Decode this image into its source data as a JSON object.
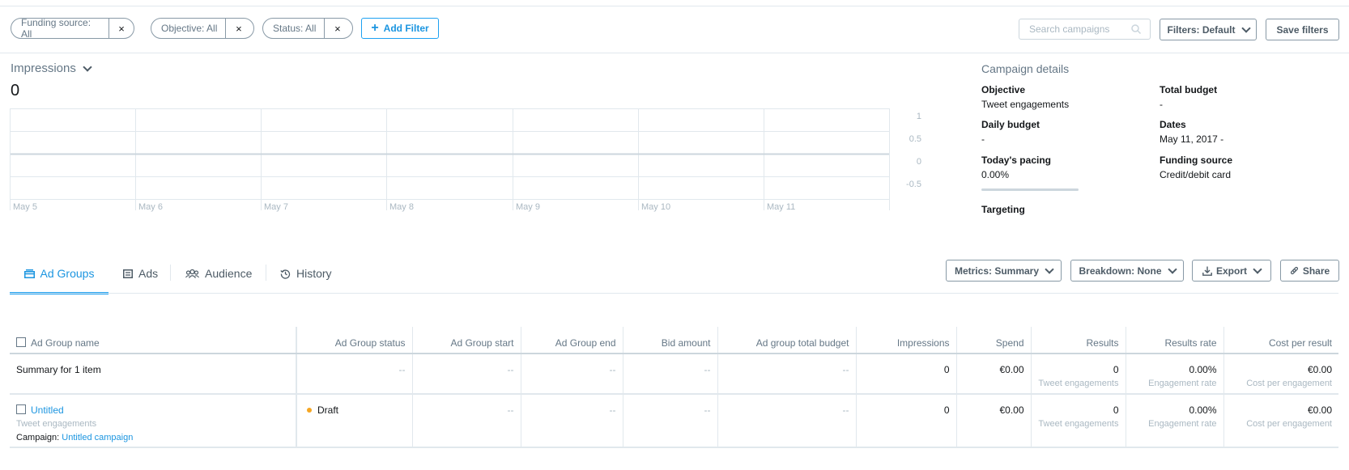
{
  "filters": {
    "chips": [
      {
        "label": "Funding source: All"
      },
      {
        "label": "Objective: All"
      },
      {
        "label": "Status: All"
      }
    ],
    "add_filter_label": "Add Filter",
    "search_placeholder": "Search campaigns",
    "filters_default_label": "Filters: Default",
    "save_filters_label": "Save filters",
    "close_glyph": "×"
  },
  "impressions": {
    "metric_label": "Impressions",
    "total": "0"
  },
  "chart_data": {
    "type": "line",
    "title": "",
    "x": [
      "May 5",
      "May 6",
      "May 7",
      "May 8",
      "May 9",
      "May 10",
      "May 11"
    ],
    "series": [
      {
        "values": [
          0,
          0,
          0,
          0,
          0,
          0,
          0
        ]
      }
    ],
    "y_ticks": [
      "1",
      "0.5",
      "0",
      "-0.5"
    ],
    "ylim": [
      -1,
      1
    ],
    "grid": true,
    "colors": {
      "grid": "#e1e8ed",
      "zero_line": "#ccd6dd",
      "tick": "#aab8c2"
    }
  },
  "campaign_details": {
    "title": "Campaign details",
    "objective_label": "Objective",
    "objective_value": "Tweet engagements",
    "total_budget_label": "Total budget",
    "total_budget_value": "-",
    "daily_budget_label": "Daily budget",
    "daily_budget_value": "-",
    "dates_label": "Dates",
    "dates_value": "May 11, 2017 -",
    "pacing_label": "Today's pacing",
    "pacing_value": "0.00%",
    "funding_source_label": "Funding source",
    "funding_source_value": "Credit/debit card",
    "targeting_label": "Targeting"
  },
  "tabs": [
    {
      "label": "Ad Groups",
      "icon": "ad-groups-icon",
      "active": true
    },
    {
      "label": "Ads",
      "icon": "ads-icon",
      "active": false
    },
    {
      "label": "Audience",
      "icon": "audience-icon",
      "active": false
    },
    {
      "label": "History",
      "icon": "history-icon",
      "active": false
    }
  ],
  "toolbar": {
    "metrics_label": "Metrics: Summary",
    "breakdown_label": "Breakdown: None",
    "export_label": "Export",
    "share_label": "Share"
  },
  "table": {
    "columns": [
      "Ad Group name",
      "Ad Group status",
      "Ad Group start",
      "Ad Group end",
      "Bid amount",
      "Ad group total budget",
      "Impressions",
      "Spend",
      "Results",
      "Results rate",
      "Cost per result"
    ],
    "summary": {
      "label": "Summary for 1 item",
      "dash": "--",
      "impressions": "0",
      "spend": "€0.00",
      "results": "0",
      "results_sub": "Tweet engagements",
      "results_rate": "0.00%",
      "results_rate_sub": "Engagement rate",
      "cost_per_result": "€0.00",
      "cost_per_result_sub": "Cost per engagement"
    },
    "rows": [
      {
        "name": "Untitled",
        "objective": "Tweet engagements",
        "campaign_label": "Campaign:",
        "campaign_name": "Untitled campaign",
        "status": "Draft",
        "dash": "--",
        "impressions": "0",
        "spend": "€0.00",
        "results": "0",
        "results_sub": "Tweet engagements",
        "results_rate": "0.00%",
        "results_rate_sub": "Engagement rate",
        "cost_per_result": "€0.00",
        "cost_per_result_sub": "Cost per engagement"
      }
    ]
  },
  "colors": {
    "accent": "#1da1f2",
    "link": "#1b95e0",
    "draft_status": "#f5a623"
  }
}
